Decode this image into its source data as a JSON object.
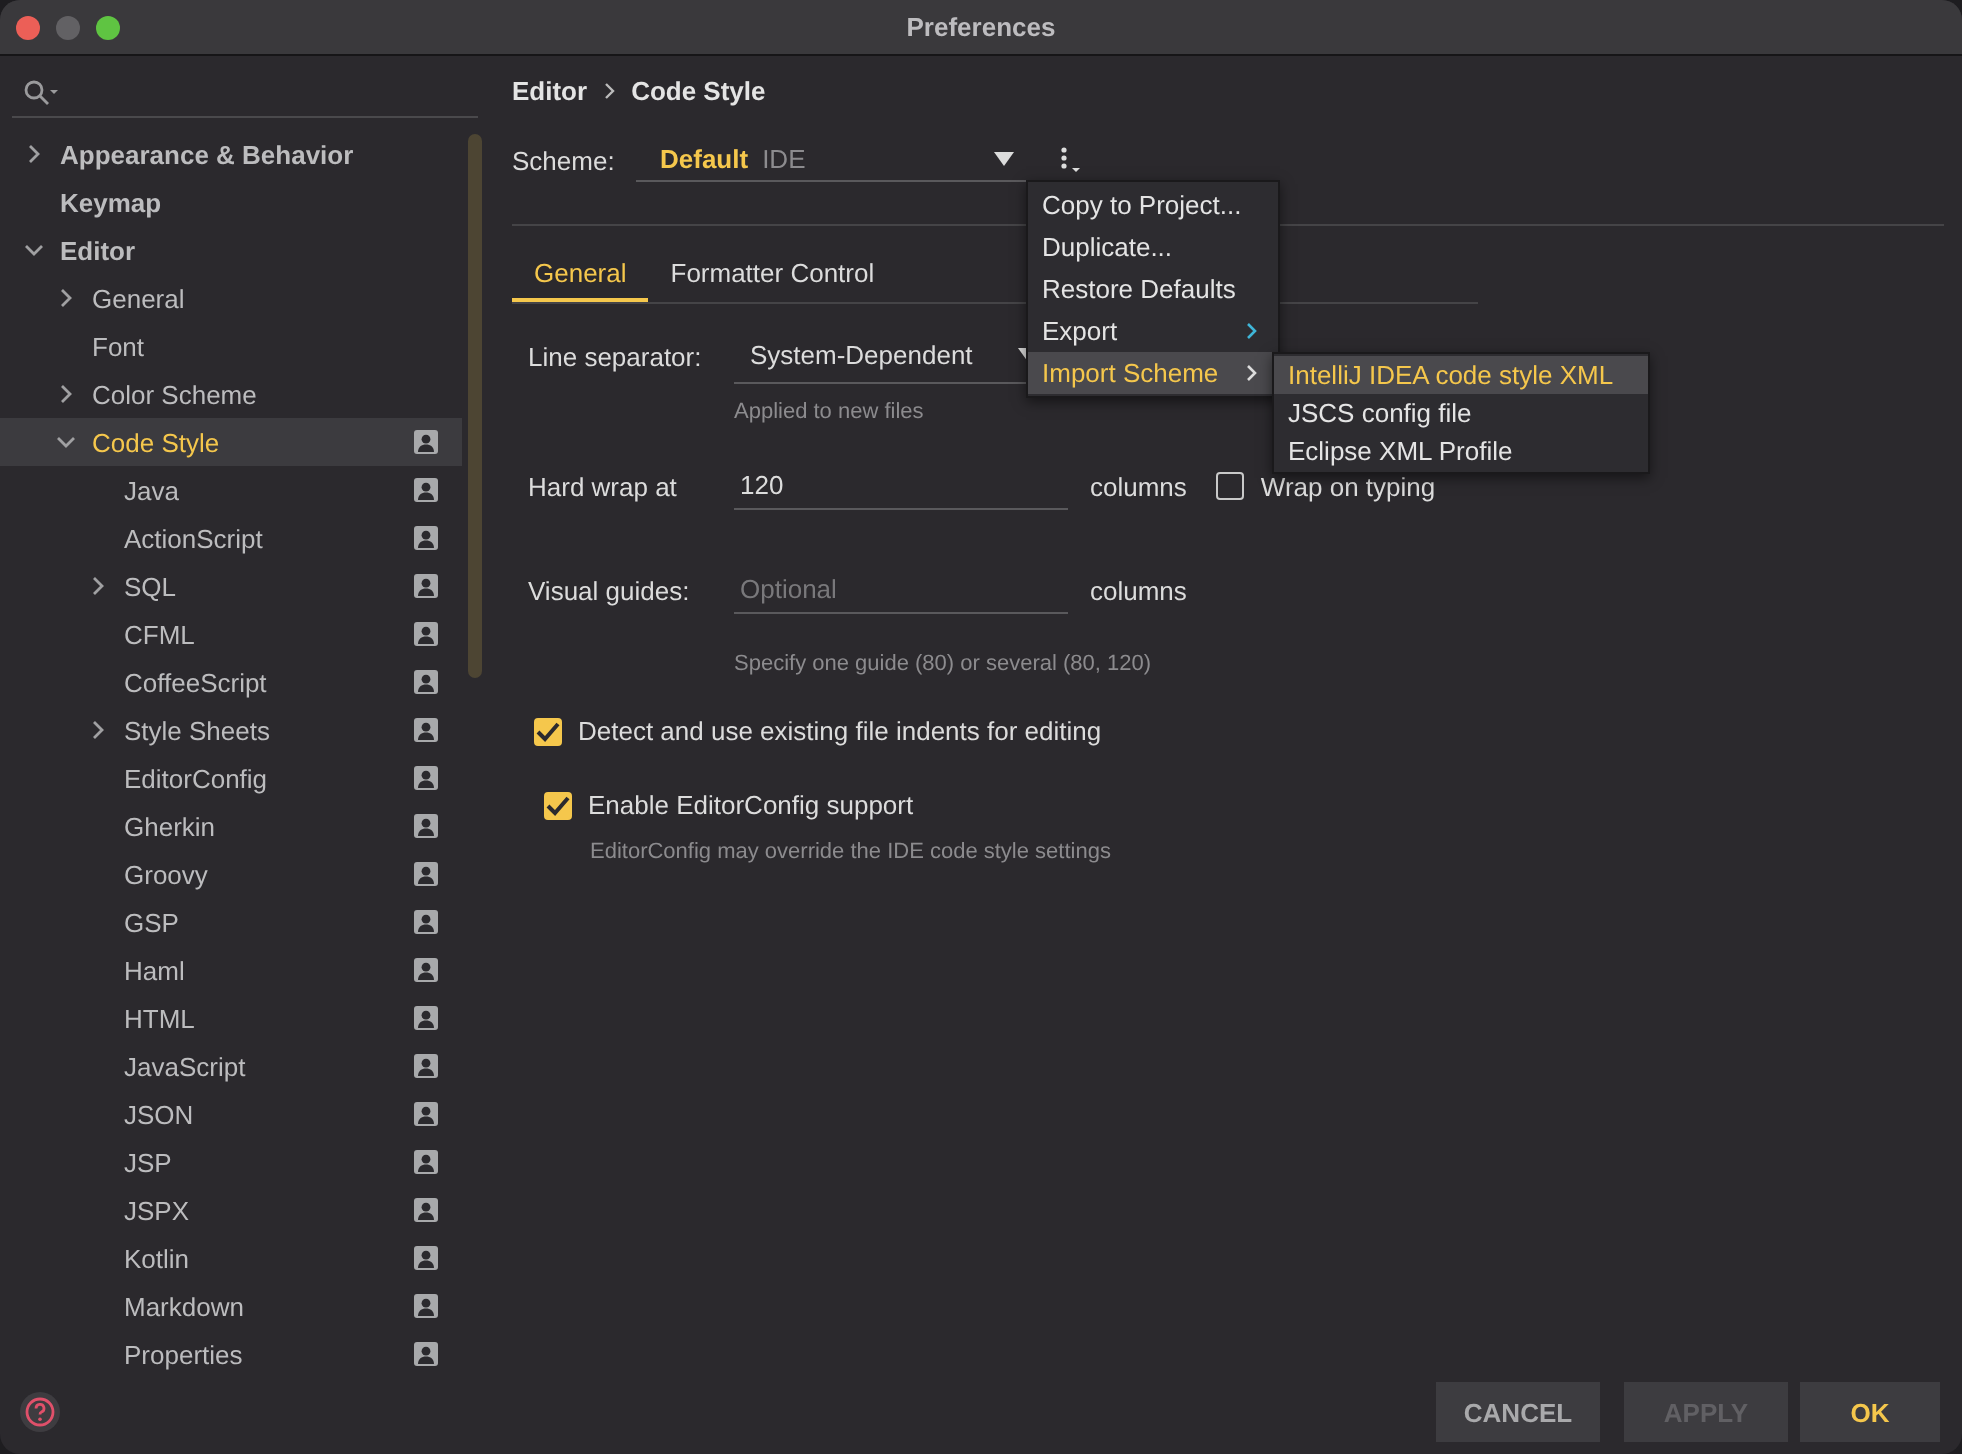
{
  "window": {
    "title": "Preferences"
  },
  "sidebar": {
    "items": [
      {
        "label": "Appearance & Behavior",
        "bold": true,
        "expanded": false,
        "selected": false
      },
      {
        "label": "Keymap",
        "bold": true,
        "selected": false
      },
      {
        "label": "Editor",
        "bold": true,
        "expanded": true,
        "selected": false,
        "children": [
          {
            "label": "General",
            "expanded": false,
            "selected": false
          },
          {
            "label": "Font",
            "selected": false
          },
          {
            "label": "Color Scheme",
            "expanded": false,
            "selected": false
          },
          {
            "label": "Code Style",
            "expanded": true,
            "selected": true,
            "scheme_icon": true,
            "children": [
              {
                "label": "Java",
                "selected": false,
                "scheme_icon": true
              },
              {
                "label": "ActionScript",
                "selected": false,
                "scheme_icon": true
              },
              {
                "label": "SQL",
                "expanded": false,
                "selected": false,
                "scheme_icon": true
              },
              {
                "label": "CFML",
                "selected": false,
                "scheme_icon": true
              },
              {
                "label": "CoffeeScript",
                "selected": false,
                "scheme_icon": true
              },
              {
                "label": "Style Sheets",
                "expanded": false,
                "selected": false,
                "scheme_icon": true
              },
              {
                "label": "EditorConfig",
                "selected": false,
                "scheme_icon": true
              },
              {
                "label": "Gherkin",
                "selected": false,
                "scheme_icon": true
              },
              {
                "label": "Groovy",
                "selected": false,
                "scheme_icon": true
              },
              {
                "label": "GSP",
                "selected": false,
                "scheme_icon": true
              },
              {
                "label": "Haml",
                "selected": false,
                "scheme_icon": true
              },
              {
                "label": "HTML",
                "selected": false,
                "scheme_icon": true
              },
              {
                "label": "JavaScript",
                "selected": false,
                "scheme_icon": true
              },
              {
                "label": "JSON",
                "selected": false,
                "scheme_icon": true
              },
              {
                "label": "JSP",
                "selected": false,
                "scheme_icon": true
              },
              {
                "label": "JSPX",
                "selected": false,
                "scheme_icon": true
              },
              {
                "label": "Kotlin",
                "selected": false,
                "scheme_icon": true
              },
              {
                "label": "Markdown",
                "selected": false,
                "scheme_icon": true
              },
              {
                "label": "Properties",
                "selected": false,
                "scheme_icon": true
              }
            ]
          }
        ]
      }
    ]
  },
  "breadcrumb": [
    "Editor",
    "Code Style"
  ],
  "scheme": {
    "label": "Scheme:",
    "name": "Default",
    "scope": "IDE"
  },
  "tabs": [
    {
      "label": "General",
      "selected": true
    },
    {
      "label": "Formatter Control",
      "selected": false
    }
  ],
  "line_separator": {
    "label": "Line separator:",
    "value": "System-Dependent",
    "hint": "Applied to new files"
  },
  "hard_wrap": {
    "label": "Hard wrap at",
    "value": "120",
    "unit": "columns",
    "wrap_on_typing": {
      "label": "Wrap on typing",
      "checked": false
    }
  },
  "visual_guides": {
    "label": "Visual guides:",
    "placeholder": "Optional",
    "unit": "columns",
    "hint": "Specify one guide (80) or several (80, 120)"
  },
  "options": [
    {
      "label": "Detect and use existing file indents for editing",
      "checked": true
    },
    {
      "label": "Enable EditorConfig support",
      "checked": true,
      "hint": "EditorConfig may override the IDE code style settings"
    }
  ],
  "menu": {
    "items": [
      {
        "label": "Copy to Project...",
        "selected": false
      },
      {
        "label": "Duplicate...",
        "selected": false
      },
      {
        "label": "Restore Defaults",
        "selected": false
      },
      {
        "label": "Export",
        "selected": false,
        "submenu": true
      },
      {
        "label": "Import Scheme",
        "selected": true,
        "submenu": true
      }
    ],
    "submenu": [
      {
        "label": "IntelliJ IDEA code style XML",
        "selected": true
      },
      {
        "label": "JSCS config file",
        "selected": false
      },
      {
        "label": "Eclipse XML Profile",
        "selected": false
      }
    ]
  },
  "buttons": [
    {
      "label": "CANCEL",
      "kind": "normal"
    },
    {
      "label": "APPLY",
      "kind": "disabled"
    },
    {
      "label": "OK",
      "kind": "default"
    }
  ]
}
